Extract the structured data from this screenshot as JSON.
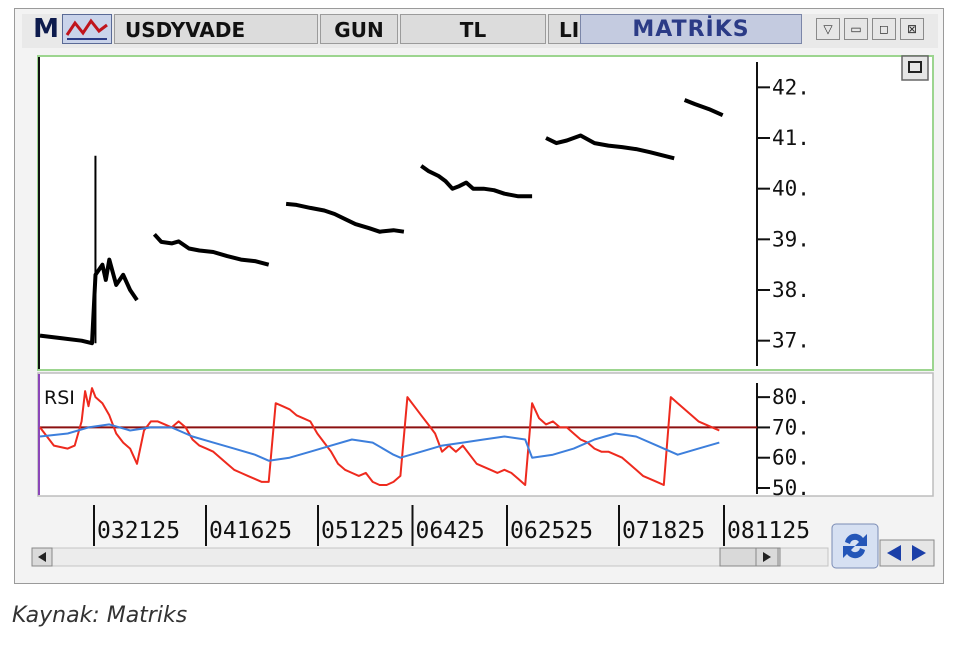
{
  "window": {
    "logo_letter": "M",
    "symbol": "USDYVADE",
    "period": "GUN",
    "currency": "TL",
    "truncated_label": "LI",
    "brand": "MATRİKS",
    "icons": [
      "chart-logo-icon",
      "dropdown-icon",
      "minimize-icon",
      "maximize-icon",
      "close-icon",
      "panel-toggle-icon",
      "refresh-icon",
      "scroll-left-icon",
      "scroll-right-icon",
      "nav-prev-icon",
      "nav-next-icon"
    ]
  },
  "caption": "Kaynak: Matriks",
  "chart_data": [
    {
      "type": "line",
      "title": "",
      "ylim": [
        36.5,
        42.5
      ],
      "yticks": [
        37,
        38,
        39,
        40,
        41,
        42
      ],
      "ytick_labels": [
        "37.",
        "38.",
        "39.",
        "40.",
        "41.",
        "42."
      ],
      "grid": false,
      "segments": [
        {
          "points": [
            [
              0,
              37.1
            ],
            [
              6,
              37.05
            ],
            [
              12,
              37.0
            ],
            [
              15,
              36.95
            ],
            [
              16,
              38.3
            ],
            [
              18,
              38.5
            ],
            [
              19,
              38.2
            ],
            [
              20,
              38.6
            ],
            [
              22,
              38.1
            ],
            [
              24,
              38.3
            ],
            [
              26,
              38.0
            ],
            [
              28,
              37.8
            ]
          ],
          "spike": {
            "x": 16,
            "low": 36.95,
            "high": 40.65
          }
        },
        {
          "points": [
            [
              33,
              39.1
            ],
            [
              35,
              38.95
            ],
            [
              38,
              38.92
            ],
            [
              40,
              38.96
            ],
            [
              43,
              38.82
            ],
            [
              46,
              38.78
            ],
            [
              50,
              38.75
            ],
            [
              54,
              38.67
            ],
            [
              58,
              38.6
            ],
            [
              62,
              38.57
            ],
            [
              66,
              38.5
            ]
          ]
        },
        {
          "points": [
            [
              71,
              39.7
            ],
            [
              74,
              39.68
            ],
            [
              78,
              39.62
            ],
            [
              82,
              39.57
            ],
            [
              85,
              39.5
            ],
            [
              88,
              39.4
            ],
            [
              91,
              39.3
            ],
            [
              95,
              39.22
            ],
            [
              98,
              39.15
            ],
            [
              102,
              39.18
            ],
            [
              105,
              39.15
            ]
          ]
        },
        {
          "points": [
            [
              110,
              40.45
            ],
            [
              112,
              40.35
            ],
            [
              115,
              40.25
            ],
            [
              117,
              40.15
            ],
            [
              119,
              40.0
            ],
            [
              121,
              40.05
            ],
            [
              123,
              40.12
            ],
            [
              125,
              40.0
            ],
            [
              128,
              40.0
            ],
            [
              131,
              39.97
            ],
            [
              134,
              39.9
            ],
            [
              138,
              39.85
            ],
            [
              142,
              39.85
            ]
          ]
        },
        {
          "points": [
            [
              146,
              41.0
            ],
            [
              149,
              40.9
            ],
            [
              152,
              40.95
            ],
            [
              156,
              41.05
            ],
            [
              160,
              40.9
            ],
            [
              164,
              40.85
            ],
            [
              168,
              40.82
            ],
            [
              172,
              40.78
            ],
            [
              176,
              40.72
            ],
            [
              180,
              40.65
            ],
            [
              183,
              40.6
            ]
          ]
        },
        {
          "points": [
            [
              186,
              41.75
            ],
            [
              189,
              41.67
            ],
            [
              193,
              41.57
            ],
            [
              197,
              41.45
            ]
          ]
        }
      ],
      "x_range": [
        0,
        204
      ]
    },
    {
      "type": "line",
      "title": "RSI",
      "ylim": [
        50,
        85
      ],
      "yticks": [
        50,
        60,
        70,
        80
      ],
      "ytick_labels": [
        "50.",
        "60.",
        "70.",
        "80."
      ],
      "reference_line": 70,
      "colors": {
        "rsi": "#ee2a1e",
        "signal": "#3d7fdc",
        "reference": "#8c1010"
      },
      "series": [
        {
          "key": "rsi",
          "x": [
            0,
            4,
            8,
            10,
            12,
            13,
            14,
            15,
            16,
            18,
            20,
            22,
            24,
            26,
            28,
            30,
            32,
            34,
            36,
            38,
            40,
            42,
            44,
            46,
            48,
            50,
            52,
            54,
            56,
            58,
            60,
            62,
            64,
            66,
            68,
            70,
            72,
            74,
            76,
            78,
            80,
            82,
            84,
            86,
            88,
            90,
            92,
            94,
            96,
            98,
            100,
            102,
            104,
            106,
            108,
            110,
            112,
            114,
            116,
            118,
            120,
            122,
            124,
            126,
            128,
            130,
            132,
            134,
            136,
            138,
            140,
            142,
            144,
            146,
            148,
            150,
            152,
            154,
            156,
            158,
            160,
            162,
            164,
            166,
            168,
            170,
            172,
            174,
            176,
            178,
            180,
            182,
            184,
            186,
            188,
            190,
            192,
            194,
            196
          ],
          "y": [
            70,
            64,
            63,
            64,
            72,
            82,
            77,
            83,
            80,
            78,
            74,
            68,
            65,
            63,
            58,
            69,
            72,
            72,
            71,
            70,
            72,
            70,
            66,
            64,
            63,
            62,
            60,
            58,
            56,
            55,
            54,
            53,
            52,
            52,
            78,
            77,
            76,
            74,
            73,
            72,
            68,
            65,
            62,
            58,
            56,
            55,
            54,
            55,
            52,
            51,
            51,
            52,
            54,
            80,
            77,
            74,
            71,
            68,
            62,
            64,
            62,
            64,
            61,
            58,
            57,
            56,
            55,
            56,
            55,
            53,
            51,
            78,
            73,
            71,
            72,
            70,
            70,
            68,
            66,
            65,
            63,
            62,
            62,
            61,
            60,
            58,
            56,
            54,
            53,
            52,
            51,
            80,
            78,
            76,
            74,
            72,
            71,
            70,
            69
          ]
        },
        {
          "key": "signal",
          "x": [
            0,
            8,
            14,
            20,
            26,
            32,
            38,
            44,
            50,
            56,
            62,
            66,
            72,
            78,
            84,
            90,
            96,
            102,
            104,
            110,
            116,
            122,
            128,
            134,
            140,
            142,
            148,
            154,
            160,
            166,
            172,
            178,
            184,
            190,
            196
          ],
          "y": [
            67,
            68,
            70,
            71,
            69,
            70,
            70,
            67,
            65,
            63,
            61,
            59,
            60,
            62,
            64,
            66,
            65,
            61,
            60,
            62,
            64,
            65,
            66,
            67,
            66,
            60,
            61,
            63,
            66,
            68,
            67,
            64,
            61,
            63,
            65
          ]
        }
      ],
      "x_range": [
        0,
        204
      ]
    }
  ],
  "x_axis": {
    "tick_labels": [
      "032125",
      "041625",
      "051225",
      "06425",
      "062525",
      "071825",
      "081125"
    ],
    "tick_positions": [
      20,
      52,
      84,
      111,
      138,
      170,
      200
    ]
  }
}
